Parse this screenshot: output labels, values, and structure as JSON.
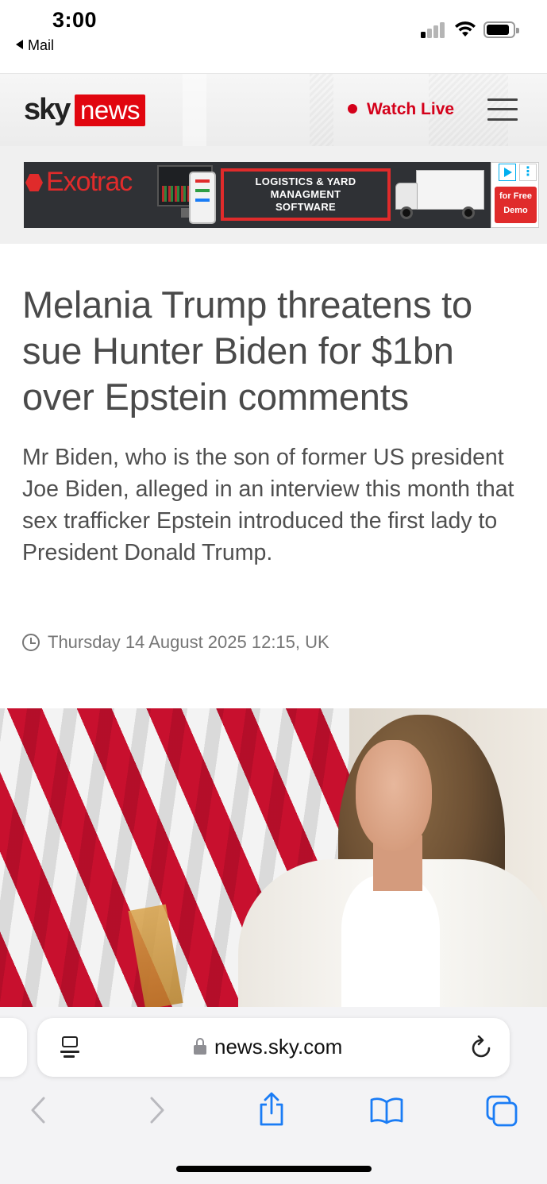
{
  "status_bar": {
    "time": "3:00",
    "back_app": "Mail"
  },
  "header": {
    "logo_sky": "sky",
    "logo_news": "news",
    "watch_live": "Watch Live",
    "brand_color": "#e1060f"
  },
  "ad": {
    "brand": "Exotrac",
    "line1": "LOGISTICS & YARD",
    "line2": "MANAGMENT",
    "line3": "SOFTWARE",
    "cta_line1": "for Free",
    "cta_line2": "Demo"
  },
  "article": {
    "headline": "Melania Trump threatens to sue Hunter Biden for $1bn over Epstein comments",
    "standfirst": "Mr Biden, who is the son of former US president Joe Biden, alleged in an interview this month that sex trafficker Epstein introduced the first lady to President Donald Trump.",
    "date": "Thursday 14 August 2025 12:15, UK"
  },
  "browser": {
    "url": "news.sky.com",
    "toolbar": [
      "back-icon",
      "forward-icon",
      "share-icon",
      "bookmarks-icon",
      "tabs-icon"
    ],
    "accent": "#1a7cf5"
  }
}
